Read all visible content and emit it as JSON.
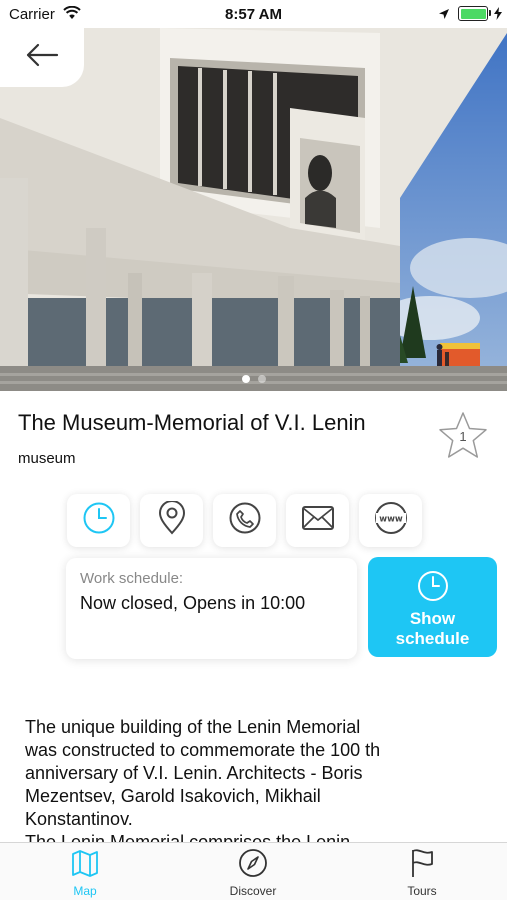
{
  "status_bar": {
    "carrier": "Carrier",
    "time": "8:57 AM",
    "accent_color": "#29c4f0",
    "battery_level": 1.0
  },
  "header": {
    "back_icon": "arrow-left-icon",
    "gallery": {
      "page_count": 2,
      "current_page": 1
    }
  },
  "place": {
    "title": "The Museum-Memorial of V.I. Lenin",
    "category": "museum",
    "favorites_count": "1"
  },
  "actions": [
    {
      "name": "work-schedule",
      "icon": "clock-icon",
      "active": true
    },
    {
      "name": "location",
      "icon": "map-pin-icon",
      "active": false
    },
    {
      "name": "call",
      "icon": "phone-icon",
      "active": false
    },
    {
      "name": "email",
      "icon": "envelope-icon",
      "active": false
    },
    {
      "name": "website",
      "icon": "www-icon",
      "active": false
    }
  ],
  "schedule": {
    "label": "Work schedule:",
    "status": "Now closed, Opens in 10:00",
    "button_label": "Show\nschedule"
  },
  "description": "The unique building of the Lenin Memorial\nwas constructed to commemorate the 100 th\nanniversary of V.I. Lenin. Architects - Boris\nMezentsev, Garold Isakovich, Mikhail\nKonstantinov.\nThe Lenin Memorial comprises the Lenin",
  "tabs": [
    {
      "label": "Map",
      "icon": "map-icon",
      "active": true
    },
    {
      "label": "Discover",
      "icon": "compass-icon",
      "active": false
    },
    {
      "label": "Tours",
      "icon": "flag-icon",
      "active": false
    }
  ],
  "colors": {
    "accent": "#1ec6f4",
    "tab_inactive": "#333333"
  }
}
